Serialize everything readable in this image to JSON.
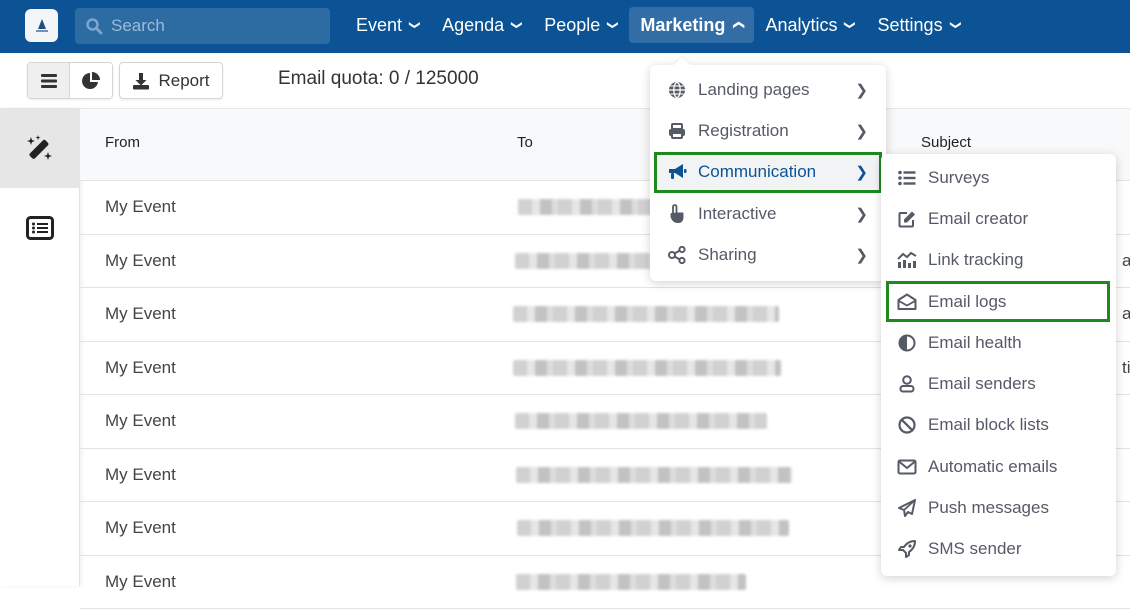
{
  "topbar": {
    "logo_alt": "app-logo",
    "search": {
      "placeholder": "Search",
      "value": ""
    },
    "nav": [
      {
        "label": "Event",
        "expanded": false
      },
      {
        "label": "Agenda",
        "expanded": false
      },
      {
        "label": "People",
        "expanded": false
      },
      {
        "label": "Marketing",
        "expanded": true
      },
      {
        "label": "Analytics",
        "expanded": false
      },
      {
        "label": "Settings",
        "expanded": false
      }
    ]
  },
  "toolbar": {
    "view_list_icon": "list-icon",
    "view_chart_icon": "pie-chart-icon",
    "report_label": "Report",
    "quota_text": "Email quota: 0 / 125000"
  },
  "sidebar": {
    "items": [
      {
        "icon": "magic-wand-icon",
        "active": true
      },
      {
        "icon": "list-alt-icon",
        "active": false
      }
    ]
  },
  "table": {
    "columns": [
      "From",
      "To",
      "Subject"
    ],
    "rows": [
      {
        "from": "My Event",
        "to": "[redacted]",
        "subject_partial": ""
      },
      {
        "from": "My Event",
        "to": "[redacted]",
        "subject_partial": "ay"
      },
      {
        "from": "My Event",
        "to": "[redacted]",
        "subject_partial": "a"
      },
      {
        "from": "My Event",
        "to": "[redacted]",
        "subject_partial": "tic"
      },
      {
        "from": "My Event",
        "to": "[redacted]",
        "subject_partial": ""
      },
      {
        "from": "My Event",
        "to": "[redacted]",
        "subject_partial": ""
      },
      {
        "from": "My Event",
        "to": "[redacted]",
        "subject_partial": ""
      },
      {
        "from": "My Event",
        "to": "[redacted]",
        "subject_partial": ""
      }
    ]
  },
  "marketing_menu": {
    "items": [
      {
        "label": "Landing pages",
        "icon": "globe-icon",
        "selected": false
      },
      {
        "label": "Registration",
        "icon": "printer-icon",
        "selected": false
      },
      {
        "label": "Communication",
        "icon": "megaphone-icon",
        "selected": true
      },
      {
        "label": "Interactive",
        "icon": "hand-pointer-icon",
        "selected": false
      },
      {
        "label": "Sharing",
        "icon": "share-icon",
        "selected": false
      }
    ]
  },
  "communication_menu": {
    "items": [
      {
        "label": "Surveys",
        "icon": "list-icon",
        "selected": false
      },
      {
        "label": "Email creator",
        "icon": "edit-icon",
        "selected": false
      },
      {
        "label": "Link tracking",
        "icon": "chart-icon",
        "selected": false
      },
      {
        "label": "Email logs",
        "icon": "envelope-open-icon",
        "selected": true
      },
      {
        "label": "Email health",
        "icon": "half-circle-icon",
        "selected": false
      },
      {
        "label": "Email senders",
        "icon": "user-icon",
        "selected": false
      },
      {
        "label": "Email block lists",
        "icon": "ban-icon",
        "selected": false
      },
      {
        "label": "Automatic emails",
        "icon": "envelope-icon",
        "selected": false
      },
      {
        "label": "Push messages",
        "icon": "paper-plane-icon",
        "selected": false
      },
      {
        "label": "SMS sender",
        "icon": "rocket-icon",
        "selected": false
      }
    ]
  },
  "colors": {
    "brand": "#0b5394",
    "highlight": "#1e8a1e",
    "menu_text": "#555a66"
  }
}
